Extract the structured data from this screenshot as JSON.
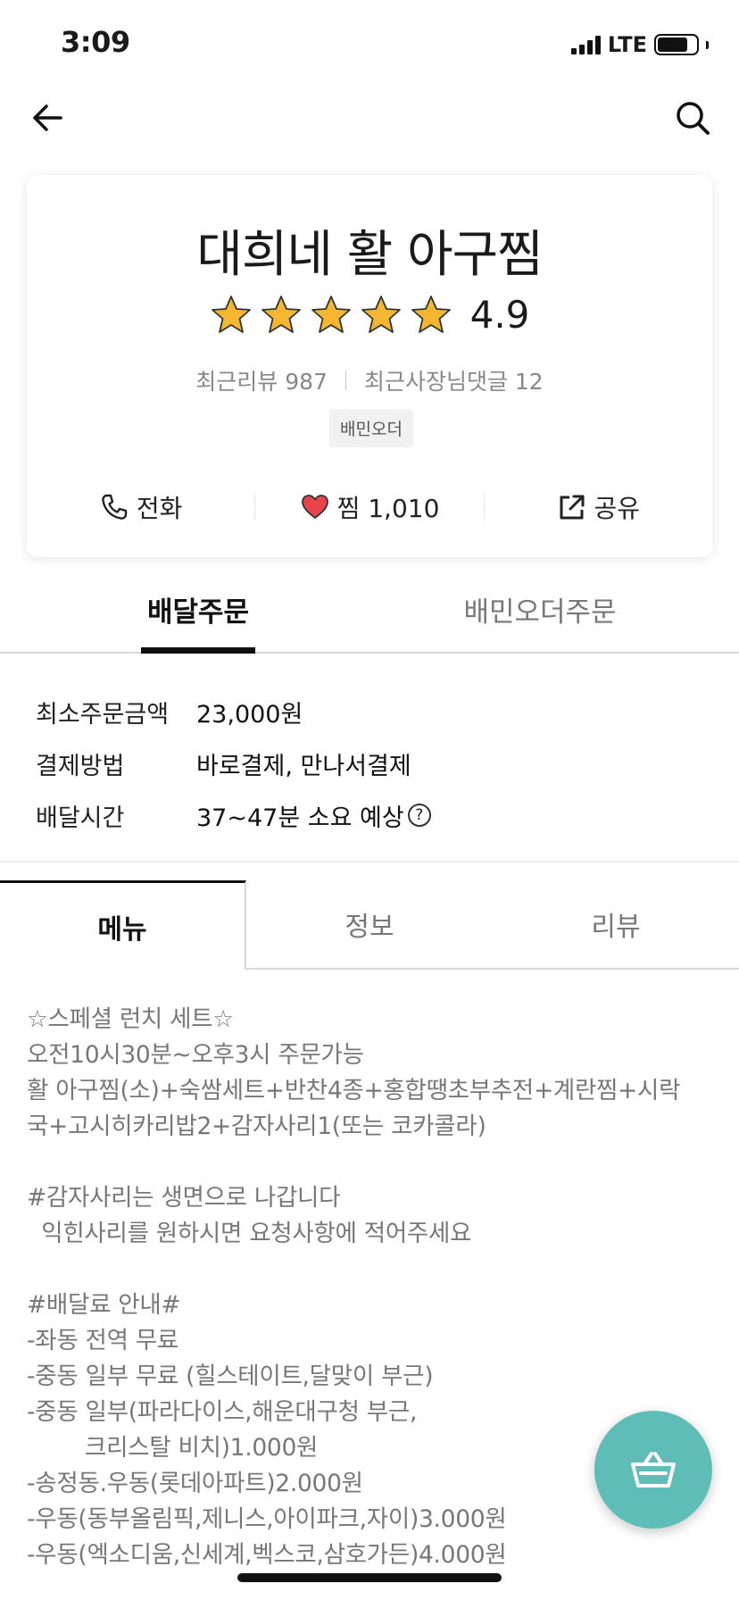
{
  "status_bar": {
    "time": "3:09",
    "network": "LTE",
    "battery_percent": 78
  },
  "store": {
    "name": "대희네 활 아구찜",
    "rating": "4.9",
    "stars_filled": 5,
    "recent_reviews": "최근리뷰 987",
    "owner_replies": "최근사장님댓글 12",
    "badge": "배민오더"
  },
  "actions": {
    "call": "전화",
    "favorite": "찜 1,010",
    "share": "공유"
  },
  "order_tabs": {
    "delivery": "배달주문",
    "baemin_order": "배민오더주문"
  },
  "info": [
    {
      "label": "최소주문금액",
      "value": "23,000원"
    },
    {
      "label": "결제방법",
      "value": "바로결제, 만나서결제"
    },
    {
      "label": "배달시간",
      "value": "37~47분 소요 예상"
    }
  ],
  "help_glyph": "?",
  "menu_tabs": {
    "menu": "메뉴",
    "info": "정보",
    "review": "리뷰"
  },
  "description": "☆스페셜 런치 세트☆\n오전10시30분~오후3시 주문가능\n활 아구찜(소)+숙쌈세트+반찬4종+홍합땡초부추전+계란찜+시락\n국+고시히카리밥2+감자사리1(또는 코카콜라)\n\n#감자사리는 생면으로 나갑니다\n  익힌사리를 원하시면 요청사항에 적어주세요\n\n#배달료 안내#\n-좌동 전역 무료\n-중동 일부 무료 (힐스테이트,달맞이 부근)\n-중동 일부(파라다이스,해운대구청 부근,\n        크리스탈 비치)1.000원\n-송정동.우동(롯데아파트)2.000원\n-우동(동부올림픽,제니스,아이파크,자이)3.000원\n-우동(엑소디움,신세계,벡스코,삼호가든)4.000원",
  "icons": {
    "back": "arrow-left-icon",
    "search": "search-icon",
    "phone": "phone-icon",
    "heart": "heart-icon",
    "share": "share-icon",
    "cart": "basket-icon"
  },
  "colors": {
    "star": "#f5b731",
    "heart": "#e8454b",
    "cart_fab": "#5fbdb7"
  }
}
